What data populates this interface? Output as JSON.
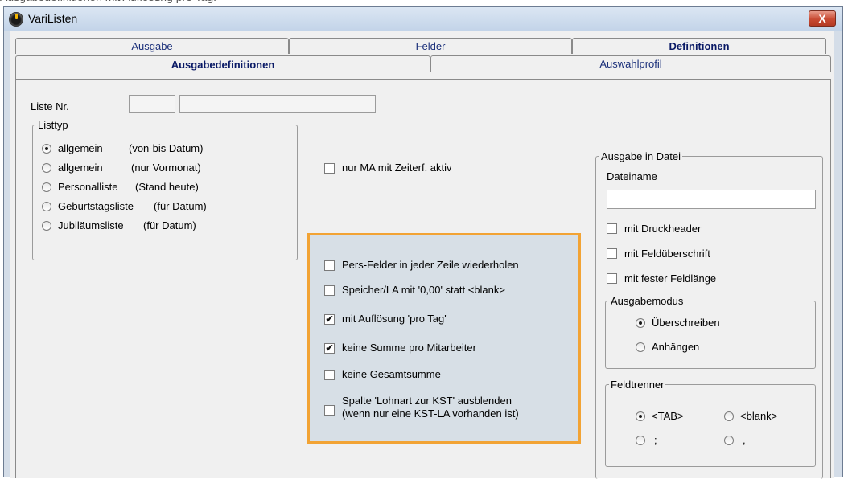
{
  "top_clip_text": "Ausgabedefinitionen mit Auflösung pro Tag:",
  "window": {
    "title": "VariListen",
    "close_label": "X"
  },
  "tabs_top": [
    "Ausgabe",
    "Felder",
    "Definitionen"
  ],
  "tabs_sub": [
    "Ausgabedefinitionen",
    "Auswahlprofil"
  ],
  "liste_nr": {
    "label": "Liste Nr.",
    "value_short": "",
    "value_long": ""
  },
  "listtyp": {
    "legend": "Listtyp",
    "options": [
      {
        "name": "allgemein",
        "detail": "(von-bis Datum)",
        "selected": true
      },
      {
        "name": "allgemein",
        "detail": "(nur Vormonat)",
        "selected": false
      },
      {
        "name": "Personalliste",
        "detail": "(Stand heute)",
        "selected": false
      },
      {
        "name": "Geburtstagsliste",
        "detail": "(für Datum)",
        "selected": false
      },
      {
        "name": "Jubiläumsliste",
        "detail": "(für Datum)",
        "selected": false
      }
    ]
  },
  "nur_ma": {
    "label": "nur MA mit Zeiterf. aktiv",
    "checked": false
  },
  "options_box": [
    {
      "label": "Pers-Felder in jeder Zeile wiederholen",
      "checked": false
    },
    {
      "label": "Speicher/LA mit '0,00' statt <blank>",
      "checked": false
    },
    {
      "label": "mit Auflösung 'pro Tag'",
      "checked": true
    },
    {
      "label": "keine Summe pro Mitarbeiter",
      "checked": true
    },
    {
      "label": "keine Gesamtsumme",
      "checked": false
    },
    {
      "label_line1": "Spalte 'Lohnart zur KST' ausblenden",
      "label_line2": "(wenn nur eine KST-LA vorhanden ist)",
      "checked": false
    }
  ],
  "ausgabe_datei": {
    "legend": "Ausgabe in Datei",
    "dateiname_label": "Dateiname",
    "dateiname_value": "",
    "checks": [
      {
        "label": "mit Druckheader",
        "checked": false
      },
      {
        "label": "mit Feldüberschrift",
        "checked": false
      },
      {
        "label": "mit fester Feldlänge",
        "checked": false
      }
    ],
    "ausgabemodus": {
      "legend": "Ausgabemodus",
      "options": [
        {
          "label": "Überschreiben",
          "selected": true
        },
        {
          "label": "Anhängen",
          "selected": false
        }
      ]
    },
    "feldtrenner": {
      "legend": "Feldtrenner",
      "options": [
        {
          "label": "<TAB>",
          "selected": true
        },
        {
          "label": "<blank>",
          "selected": false
        },
        {
          "label": ";",
          "selected": false
        },
        {
          "label": ",",
          "selected": false
        }
      ]
    }
  },
  "colors": {
    "highlight_border": "#f2a334",
    "tab_text": "#1a2f7a",
    "window_frame": "#d4dde8"
  }
}
